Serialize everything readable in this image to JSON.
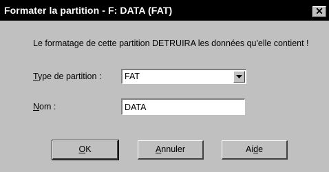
{
  "window": {
    "title": "Formater la partition - F: DATA (FAT)",
    "close_glyph": "✕"
  },
  "message": "Le formatage de cette partition DETRUIRA les données qu'elle contient !",
  "partition_type": {
    "label_mnemonic": "T",
    "label_rest": "ype de partition :",
    "value": "FAT"
  },
  "name": {
    "label_mnemonic": "N",
    "label_rest": "om :",
    "value": "DATA"
  },
  "buttons": {
    "ok": {
      "mnemonic": "O",
      "rest": "K"
    },
    "cancel": {
      "mnemonic": "A",
      "rest": "nnuler"
    },
    "help": {
      "pre": "Ai",
      "mnemonic": "d",
      "rest": "e"
    }
  }
}
